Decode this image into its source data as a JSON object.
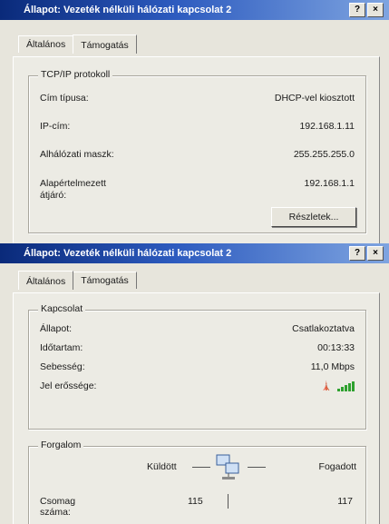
{
  "dialog1": {
    "title": "Állapot: Vezeték nélküli hálózati kapcsolat 2",
    "help": "?",
    "close": "×",
    "tabs": [
      "Általános",
      "Támogatás"
    ],
    "group_title": "TCP/IP protokoll",
    "rows": [
      {
        "label": "Cím típusa:",
        "value": "DHCP-vel kiosztott"
      },
      {
        "label": "IP-cím:",
        "value": "192.168.1.11"
      },
      {
        "label": "Alhálózati maszk:",
        "value": "255.255.255.0"
      },
      {
        "label": "Alapértelmezett átjáró:",
        "value": "192.168.1.1"
      }
    ],
    "details_button": "Részletek..."
  },
  "dialog2": {
    "title": "Állapot: Vezeték nélküli hálózati kapcsolat 2",
    "help": "?",
    "close": "×",
    "tabs": [
      "Általános",
      "Támogatás"
    ],
    "connection_title": "Kapcsolat",
    "rows": [
      {
        "label": "Állapot:",
        "value": "Csatlakoztatva"
      },
      {
        "label": "Időtartam:",
        "value": "00:13:33"
      },
      {
        "label": "Sebesség:",
        "value": "11,0 Mbps"
      },
      {
        "label": "Jel erőssége:",
        "value": ""
      }
    ],
    "signal_strength_bars": 5,
    "signal_color": "#2fa12f",
    "traffic_title": "Forgalom",
    "sent_label": "Küldött",
    "received_label": "Fogadott",
    "packets_label": "Csomag száma:",
    "sent_value": "115",
    "received_value": "117"
  }
}
